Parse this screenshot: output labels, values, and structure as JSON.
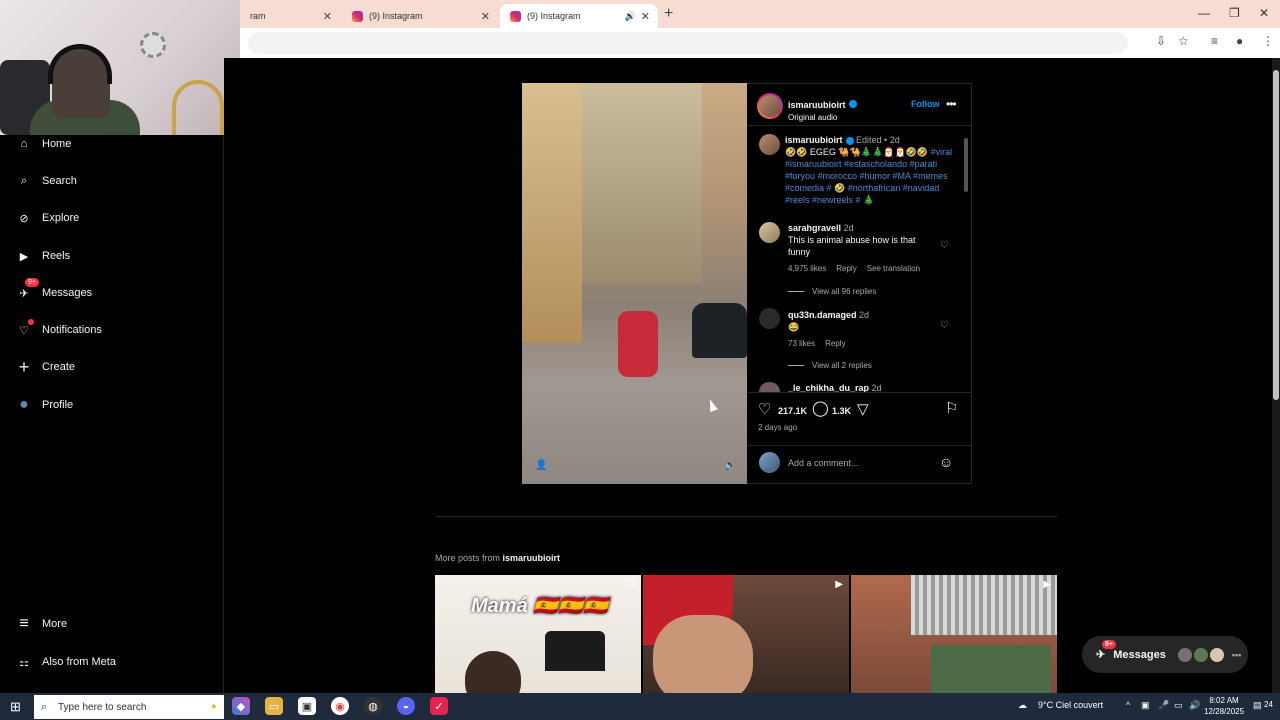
{
  "browser": {
    "tabs": [
      {
        "title": "ram"
      },
      {
        "title": "(9) Instagram"
      },
      {
        "title": "(9) Instagram"
      }
    ],
    "close_glyph": "✕",
    "new_tab_glyph": "+",
    "window_controls": [
      "—",
      "❐",
      "✕"
    ]
  },
  "sidebar": {
    "items": [
      {
        "label": "Home",
        "icon": "⌂"
      },
      {
        "label": "Search",
        "icon": "⌕"
      },
      {
        "label": "Explore",
        "icon": "⊘"
      },
      {
        "label": "Reels",
        "icon": "▶"
      },
      {
        "label": "Messages",
        "icon": "✈",
        "badge": "9+"
      },
      {
        "label": "Notifications",
        "icon": "♡"
      },
      {
        "label": "Create",
        "icon": "+"
      },
      {
        "label": "Profile",
        "icon": "●"
      }
    ],
    "bottom": [
      {
        "label": "More",
        "icon": "≡"
      },
      {
        "label": "Also from Meta",
        "icon": "⚏"
      }
    ]
  },
  "post": {
    "author": "ismaruubioirt",
    "audio": "Original audio",
    "follow_label": "Follow",
    "more_glyph": "•••",
    "caption_user": "ismaruubioirt",
    "caption_meta": "Edited • 2d",
    "caption_text": "🤣🤣 EGEG 🐫🐪🎄🎄🎅🎅🤣🤣",
    "caption_hashtags": "#viral #ismaruubioirt #estascholando #parati #foryou #morocco #humor #MA #memes #comedia # 🤣 #northafrican #navidad #reels #newreels # 🎄",
    "comments": [
      {
        "user": "sarahgravell",
        "age": "2d",
        "text": "This is animal abuse how is that funny",
        "likes": "4,975 likes",
        "reply": "Reply",
        "translate": "See translation",
        "replies": "View all 96 replies"
      },
      {
        "user": "qu33n.damaged",
        "age": "2d",
        "text": "😂",
        "likes": "73 likes",
        "reply": "Reply",
        "replies": "View all 2 replies"
      },
      {
        "user": "_le_chikha_du_rap",
        "age": "2d"
      }
    ],
    "like_count": "217.1K",
    "comment_count": "1.3K",
    "time_ago": "2 days ago",
    "add_comment_placeholder": "Add a comment..."
  },
  "more_posts": {
    "prefix": "More posts from",
    "user": "ismaruubioirt",
    "thumb1_text": "Mamá 🇪🇸🇪🇸🇪🇸"
  },
  "messages_fab": {
    "label": "Messages",
    "badge": "9+",
    "more": "•••"
  },
  "taskbar": {
    "search_placeholder": "Type here to search",
    "weather": "9°C  Ciel couvert",
    "time": "8:02 AM",
    "date": "12/28/2025",
    "notif_count": "24"
  }
}
